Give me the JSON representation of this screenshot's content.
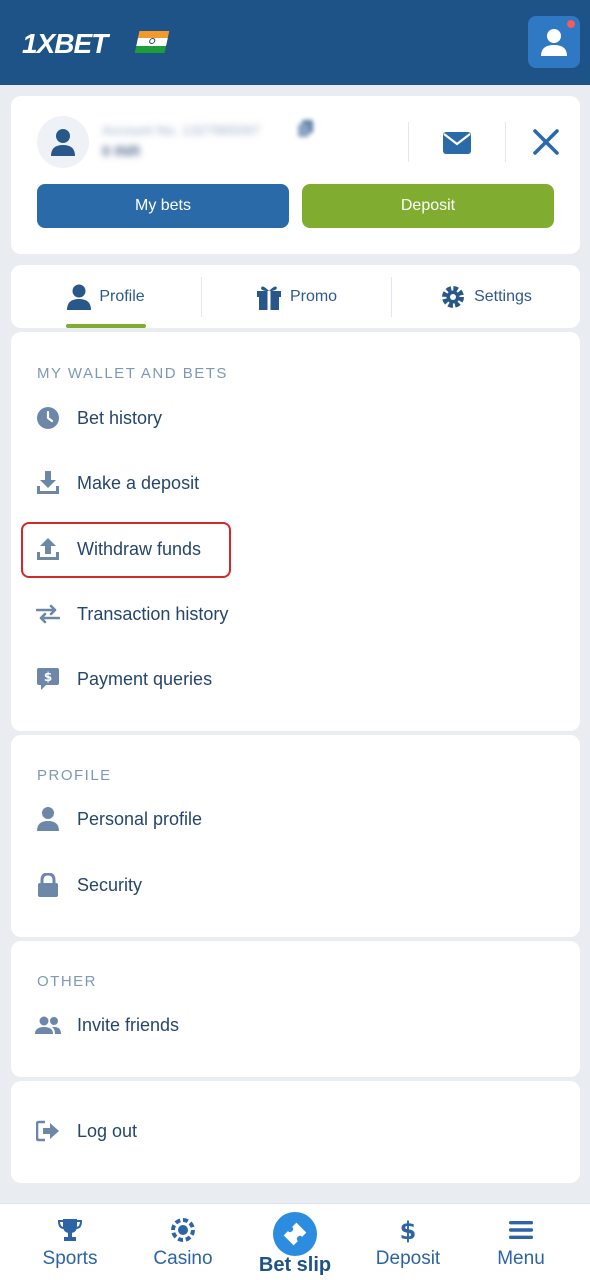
{
  "header": {
    "logo_text_1x": "1X",
    "logo_text_bet": "BET"
  },
  "account": {
    "account_line": "Account No. 1327965097",
    "balance": "0 INR",
    "my_bets_label": "My bets",
    "deposit_label": "Deposit"
  },
  "tabs": [
    {
      "label": "Profile",
      "active": true
    },
    {
      "label": "Promo",
      "active": false
    },
    {
      "label": "Settings",
      "active": false
    }
  ],
  "sections": {
    "wallet": {
      "title": "MY WALLET AND BETS",
      "items": [
        "Bet history",
        "Make a deposit",
        "Withdraw funds",
        "Transaction history",
        "Payment queries"
      ]
    },
    "profile": {
      "title": "PROFILE",
      "items": [
        "Personal profile",
        "Security"
      ]
    },
    "other": {
      "title": "OTHER",
      "items": [
        "Invite friends"
      ]
    },
    "logout": {
      "items": [
        "Log out"
      ]
    }
  },
  "bottom_nav": [
    {
      "label": "Sports",
      "icon": "trophy-icon"
    },
    {
      "label": "Casino",
      "icon": "casino-chip-icon"
    },
    {
      "label": "Bet slip",
      "icon": "ticket-icon"
    },
    {
      "label": "Deposit",
      "icon": "dollar-icon"
    },
    {
      "label": "Menu",
      "icon": "hamburger-icon"
    }
  ],
  "colors": {
    "header_bg": "#1d5386",
    "accent_blue": "#2a6aa9",
    "accent_green": "#80ad2f",
    "highlight_red": "#d32929"
  }
}
